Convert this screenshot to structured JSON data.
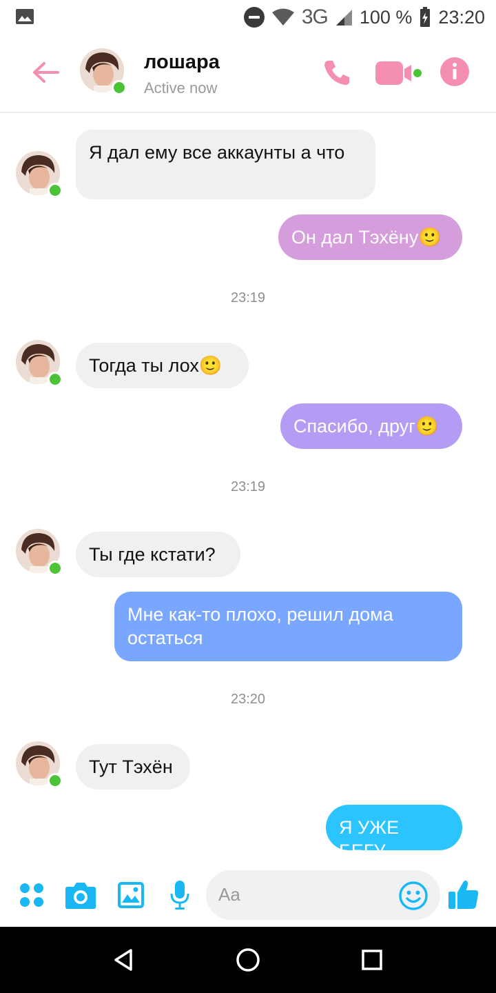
{
  "status_bar": {
    "network": "3G",
    "battery": "100 %",
    "time": "23:20",
    "icons": [
      "gallery-icon",
      "do-not-disturb-icon",
      "wifi-icon",
      "signal-icon",
      "battery-charging-icon"
    ]
  },
  "header": {
    "contact_name": "лошара",
    "presence": "Active now",
    "icons": [
      "back-arrow-icon",
      "phone-icon",
      "video-camera-icon",
      "info-icon"
    ]
  },
  "messages": [
    {
      "side": "in",
      "text": "Я дал ему все аккаунты а что"
    },
    {
      "side": "out",
      "text": "Он дал Тэхёну🙂",
      "color": "#d69ddd"
    },
    {
      "type": "timestamp",
      "text": "23:19"
    },
    {
      "side": "in",
      "text": "Тогда ты лох🙂"
    },
    {
      "side": "out",
      "text": "Спасибо, друг🙂",
      "color": "#b49cf4"
    },
    {
      "type": "timestamp",
      "text": "23:19"
    },
    {
      "side": "in",
      "text": "Ты где кстати?"
    },
    {
      "side": "out",
      "text": "Мне как-то плохо, решил дома остаться",
      "color": "#79a7ff"
    },
    {
      "type": "timestamp",
      "text": "23:20"
    },
    {
      "side": "in",
      "text": "Тут Тэхён"
    },
    {
      "side": "out",
      "text": "Я УЖЕ БЕГУ",
      "color": "#2cc4ff"
    }
  ],
  "composer": {
    "placeholder": "Aa",
    "icons": [
      "apps-icon",
      "camera-icon",
      "gallery-icon",
      "microphone-icon",
      "emoji-icon",
      "thumbs-up-icon"
    ]
  },
  "colors": {
    "header_accent": "#f48fb1",
    "composer_accent": "#19b8f5",
    "online_dot": "#4cc337",
    "incoming_bubble": "#f0f0f2"
  }
}
